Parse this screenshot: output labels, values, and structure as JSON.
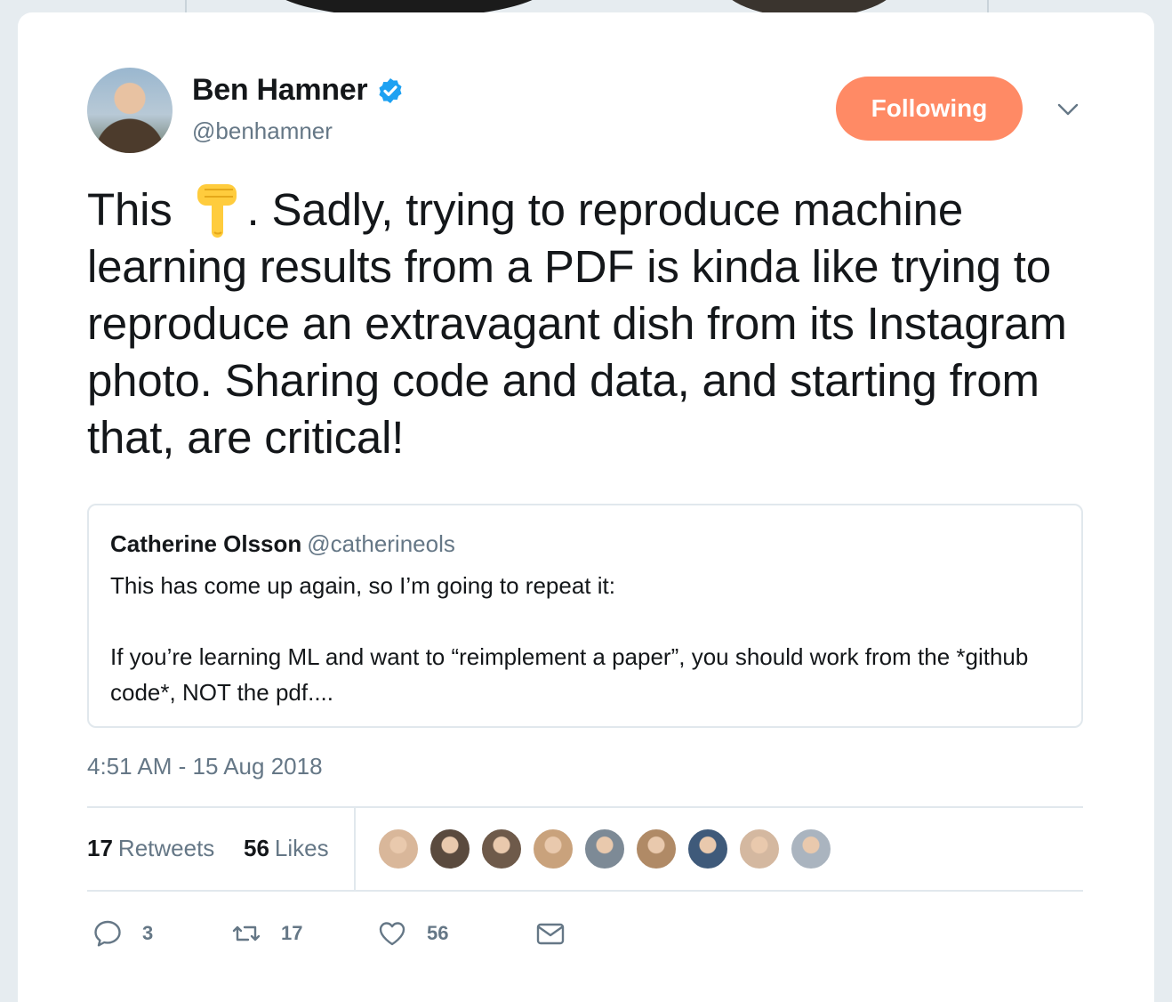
{
  "author": {
    "name": "Ben Hamner",
    "handle": "@benhamner",
    "verified_icon": "verified-badge-icon"
  },
  "follow_button": {
    "label": "Following"
  },
  "menu": {
    "icon": "chevron-down-icon"
  },
  "tweet": {
    "text_before_emoji": "This",
    "emoji": "backhand-index-pointing-down",
    "text_after_emoji": ". Sadly, trying to reproduce machine learning results from a PDF is kinda like trying to reproduce an extravagant dish from its Instagram photo. Sharing code and data, and starting from that, are critical!"
  },
  "quoted_tweet": {
    "name": "Catherine Olsson",
    "handle": "@catherineols",
    "line1": "This has come up again, so I’m going to repeat it:",
    "line2": "If you’re learning ML and want to “reimplement a paper”, you should work from the *github code*, NOT the pdf...."
  },
  "timestamp": "4:51 AM - 15 Aug 2018",
  "stats": {
    "retweets_count": "17",
    "retweets_label": "Retweets",
    "likes_count": "56",
    "likes_label": "Likes"
  },
  "likers": [
    {
      "color": "#d9b79a"
    },
    {
      "color": "#5a4a3e"
    },
    {
      "color": "#6e5a4a"
    },
    {
      "color": "#c9a27c"
    },
    {
      "color": "#7d8a96"
    },
    {
      "color": "#b08a66"
    },
    {
      "color": "#3f5a7a"
    },
    {
      "color": "#d4b8a0"
    },
    {
      "color": "#aab4bf"
    }
  ],
  "actions": {
    "reply_count": "3",
    "retweet_count": "17",
    "like_count": "56"
  },
  "colors": {
    "accent": "#1da1f2",
    "follow_button": "#ff8a65",
    "muted": "#657786",
    "text": "#14171a",
    "border": "#e1e8ed"
  }
}
